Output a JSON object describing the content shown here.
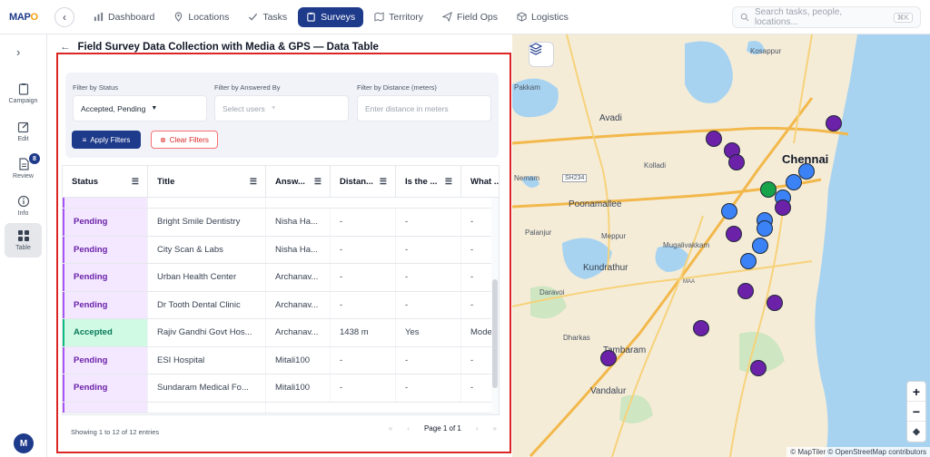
{
  "app": {
    "logo_text": "MAPO"
  },
  "nav": {
    "items": [
      {
        "label": "Dashboard",
        "active": false
      },
      {
        "label": "Locations",
        "active": false
      },
      {
        "label": "Tasks",
        "active": false
      },
      {
        "label": "Surveys",
        "active": true
      },
      {
        "label": "Territory",
        "active": false
      },
      {
        "label": "Field Ops",
        "active": false
      },
      {
        "label": "Logistics",
        "active": false
      }
    ],
    "search_placeholder": "Search tasks, people, locations...",
    "search_shortcut": "⌘K"
  },
  "sidebar": {
    "items": [
      {
        "label": "Campaign"
      },
      {
        "label": "Edit"
      },
      {
        "label": "Review",
        "badge": "8"
      },
      {
        "label": "Info"
      },
      {
        "label": "Table",
        "active": true
      }
    ],
    "avatar": "M"
  },
  "page": {
    "title": "Field Survey Data Collection with Media & GPS — Data Table"
  },
  "filters": {
    "status_label": "Filter by Status",
    "status_value": "Accepted, Pending",
    "answered_label": "Filter by Answered By",
    "answered_placeholder": "Select users",
    "distance_label": "Filter by Distance (meters)",
    "distance_placeholder": "Enter distance in meters",
    "apply_label": "Apply Filters",
    "clear_label": "Clear Filters"
  },
  "table": {
    "columns": [
      "Status",
      "Title",
      "Answ...",
      "Distan...",
      "Is the ...",
      "What ..."
    ],
    "rows": [
      {
        "status": "Pending",
        "title": "Bright Smile Dentistry",
        "answered": "Nisha Ha...",
        "distance": "-",
        "is_the": "-",
        "what": "-"
      },
      {
        "status": "Pending",
        "title": "City Scan & Labs",
        "answered": "Nisha Ha...",
        "distance": "-",
        "is_the": "-",
        "what": "-"
      },
      {
        "status": "Pending",
        "title": "Urban Health Center",
        "answered": "Archanav...",
        "distance": "-",
        "is_the": "-",
        "what": "-"
      },
      {
        "status": "Pending",
        "title": "Dr Tooth Dental Clinic",
        "answered": "Archanav...",
        "distance": "-",
        "is_the": "-",
        "what": "-"
      },
      {
        "status": "Accepted",
        "title": "Rajiv Gandhi Govt Hos...",
        "answered": "Archanav...",
        "distance": "1438 m",
        "is_the": "Yes",
        "what": "Mode..."
      },
      {
        "status": "Pending",
        "title": "ESI Hospital",
        "answered": "Mitali100",
        "distance": "-",
        "is_the": "-",
        "what": "-"
      },
      {
        "status": "Pending",
        "title": "Sundaram Medical Fo...",
        "answered": "Mitali100",
        "distance": "-",
        "is_the": "-",
        "what": "-"
      }
    ],
    "footer": "Showing 1 to 12 of 12 entries",
    "page_label": "Page 1 of 1"
  },
  "map": {
    "labels": {
      "kosappur": "Kosappur",
      "avadi": "Avadi",
      "pakkam": "Pakkam",
      "kolladi": "Kolladi",
      "chennai": "Chennai",
      "nemam": "Nemam",
      "sh234": "SH234",
      "poonamallee": "Poonamallee",
      "palanjur": "Palanjur",
      "meppur": "Meppur",
      "mugalivakkam": "Mugalivakkam",
      "kundrathur": "Kundrathur",
      "maa": "MAA",
      "daravoi": "Daravoi",
      "dharkas": "Dharkas",
      "tambaram": "Tambaram",
      "vandalur": "Vandalur"
    },
    "zoom_in": "+",
    "zoom_out": "−",
    "attribution": "© MapTiler © OpenStreetMap contributors"
  }
}
